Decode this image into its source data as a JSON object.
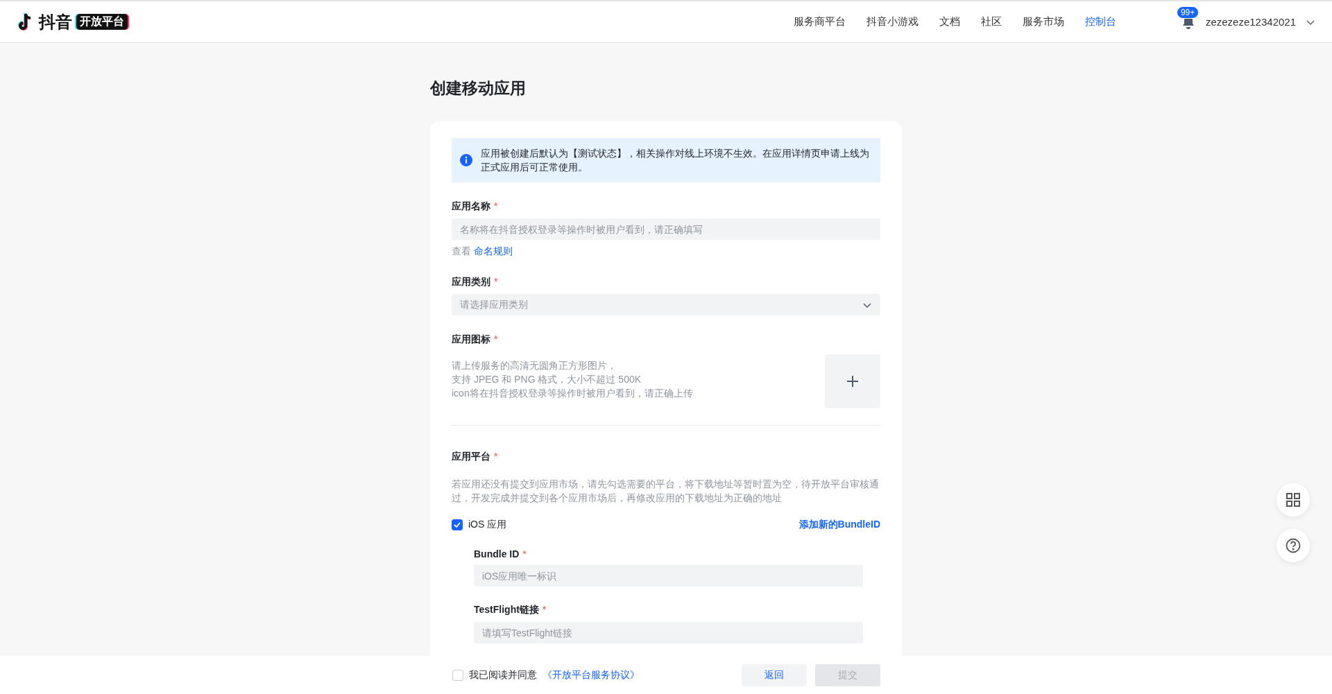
{
  "header": {
    "logo": {
      "wordmark": "抖音",
      "badge": "开放平台"
    },
    "nav": [
      {
        "label": "服务商平台",
        "selected": false
      },
      {
        "label": "抖音小游戏",
        "selected": false
      },
      {
        "label": "文档",
        "selected": false
      },
      {
        "label": "社区",
        "selected": false
      },
      {
        "label": "服务市场",
        "selected": false
      },
      {
        "label": "控制台",
        "selected": true
      }
    ],
    "notifications": {
      "badge": "99+"
    },
    "user": {
      "name": "zezezeze12342021"
    }
  },
  "page": {
    "title": "创建移动应用"
  },
  "notice": "应用被创建后默认为【测试状态】，相关操作对线上环境不生效。在应用详情页申请上线为正式应用后可正常使用。",
  "fields": [
    {
      "kind": "text",
      "label": "应用名称",
      "required": "*",
      "placeholder": "名称将在抖音授权登录等操作时被用户看到，请正确填写",
      "hint": "查看",
      "hint_link": "命名规则"
    },
    {
      "kind": "select",
      "label": "应用类别",
      "required": "*",
      "placeholder": "请选择应用类别"
    },
    {
      "kind": "upload",
      "label": "应用图标",
      "required": "*",
      "lines": [
        "请上传服务的高清无圆角正方形图片，",
        "支持 JPEG 和 PNG 格式，大小不超过 500K",
        "icon将在抖音授权登录等操作时被用户看到，请正确上传"
      ]
    }
  ],
  "platform": {
    "label": "应用平台",
    "required": "*",
    "description": "若应用还没有提交到应用市场，请先勾选需要的平台，将下载地址等暂时置为空，待开放平台审核通过，开发完成并提交到各个应用市场后，再修改应用的下载地址为正确的地址",
    "options": [
      {
        "label": "iOS 应用",
        "checked": true,
        "action": "添加新的BundleID",
        "fields": [
          {
            "label": "Bundle ID",
            "required": "*",
            "placeholder": "iOS应用唯一标识"
          },
          {
            "label": "TestFlight链接",
            "required": "*",
            "placeholder": "请填写TestFlight链接"
          }
        ]
      }
    ]
  },
  "footer": {
    "agreement": {
      "checked": false,
      "text": "我已阅读并同意",
      "link": "《开放平台服务协议》"
    },
    "buttons": [
      {
        "label": "返回",
        "disabled": false
      },
      {
        "label": "提交",
        "disabled": true
      }
    ]
  }
}
